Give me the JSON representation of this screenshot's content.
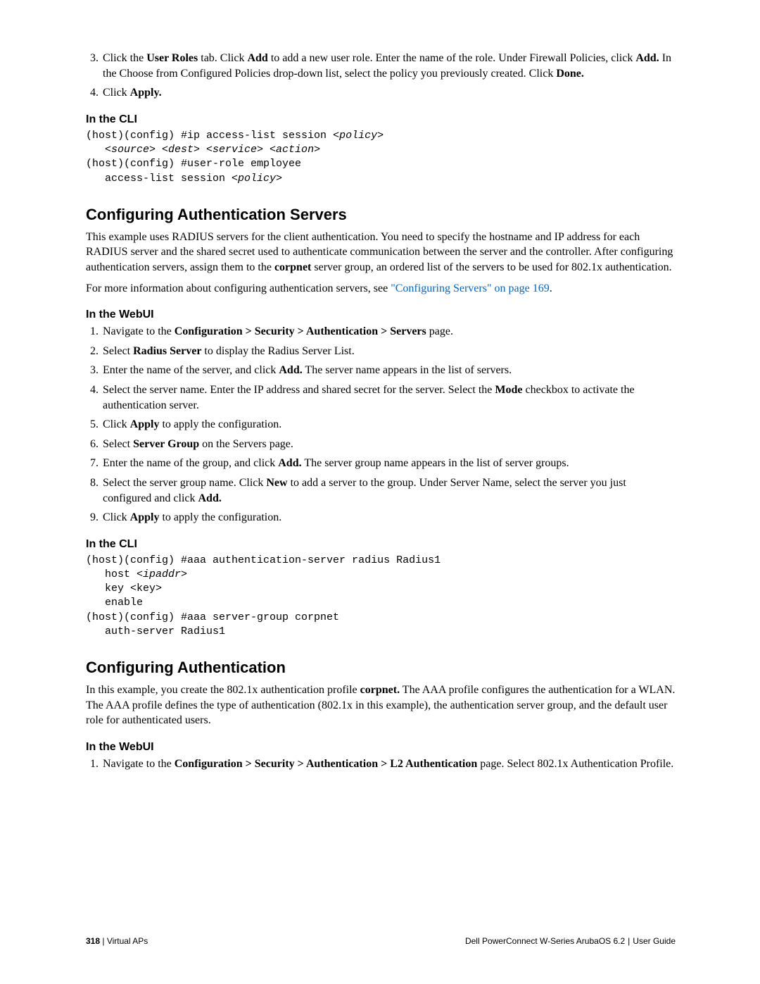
{
  "top_steps_start": 3,
  "top_steps": [
    {
      "pre": "Click the ",
      "b1": "User Roles",
      "mid1": " tab. Click ",
      "b2": "Add",
      "mid2": " to add a new user role. Enter the name of the role. Under Firewall Policies, click ",
      "b3": "Add.",
      "mid3": " In the Choose from Configured Policies drop-down list, select the policy you previously created. Click ",
      "b4": "Done.",
      "tail": ""
    },
    {
      "pre": "Click ",
      "b1": "Apply.",
      "mid1": "",
      "b2": "",
      "mid2": "",
      "b3": "",
      "mid3": "",
      "b4": "",
      "tail": ""
    }
  ],
  "cli_heading": "In the CLI",
  "cli1_l1a": "(host)(config) #ip access-list session ",
  "cli1_l1b": "<policy>",
  "cli1_l2a": "   ",
  "cli1_l2b": "<source> <dest> <service> <action>",
  "cli1_l3": "(host)(config) #user-role employee",
  "cli1_l4a": "   access-list session ",
  "cli1_l4b": "<policy>",
  "h2_auth_servers": "Configuring Authentication Servers",
  "auth_servers_p1a": "This example uses RADIUS servers for the client authentication. You need to specify the hostname and IP address for each RADIUS server and the shared secret used to authenticate communication between the server and the controller. After configuring authentication servers, assign them to the ",
  "auth_servers_p1b": "corpnet",
  "auth_servers_p1c": " server group, an ordered list of the servers to be used for 802.1x authentication.",
  "auth_servers_p2a": "For more information about configuring authentication servers, see ",
  "auth_servers_link": "\"Configuring Servers\" on page 169",
  "auth_servers_p2b": ".",
  "webui_heading": "In the WebUI",
  "webui1_steps": [
    {
      "t": [
        {
          "s": "Navigate to the "
        },
        {
          "b": "Configuration > Security > Authentication > Servers"
        },
        {
          "s": " page."
        }
      ]
    },
    {
      "t": [
        {
          "s": "Select "
        },
        {
          "b": "Radius Server"
        },
        {
          "s": " to display the Radius Server List."
        }
      ]
    },
    {
      "t": [
        {
          "s": "Enter the name of the server, and click "
        },
        {
          "b": "Add."
        },
        {
          "s": " The server name appears in the list of servers."
        }
      ]
    },
    {
      "t": [
        {
          "s": "Select the server name. Enter the IP address and shared secret for the server. Select the "
        },
        {
          "b": "Mode"
        },
        {
          "s": " checkbox to activate the authentication server."
        }
      ]
    },
    {
      "t": [
        {
          "s": "Click "
        },
        {
          "b": "Apply"
        },
        {
          "s": " to apply the configuration."
        }
      ]
    },
    {
      "t": [
        {
          "s": "Select "
        },
        {
          "b": "Server Group"
        },
        {
          "s": " on the Servers page."
        }
      ]
    },
    {
      "t": [
        {
          "s": "Enter the name of the group, and click "
        },
        {
          "b": "Add."
        },
        {
          "s": " The server group name appears in the list of server groups."
        }
      ]
    },
    {
      "t": [
        {
          "s": "Select the server group name. Click "
        },
        {
          "b": "New"
        },
        {
          "s": " to add a server to the group. Under Server Name, select the server you just configured and click "
        },
        {
          "b": "Add."
        }
      ]
    },
    {
      "t": [
        {
          "s": "Click "
        },
        {
          "b": "Apply"
        },
        {
          "s": " to apply the configuration."
        }
      ]
    }
  ],
  "cli2_l1": "(host)(config) #aaa authentication-server radius Radius1",
  "cli2_l2a": "   host ",
  "cli2_l2b": "<ipaddr>",
  "cli2_l3": "   key <key>",
  "cli2_l4": "   enable",
  "cli2_l5": "(host)(config) #aaa server-group corpnet",
  "cli2_l6": "   auth-server Radius1",
  "h2_config_auth": "Configuring Authentication",
  "config_auth_p1a": "In this example, you create the 802.1x authentication profile ",
  "config_auth_p1b": "corpnet.",
  "config_auth_p1c": " The AAA profile configures the authentication for a WLAN. The AAA profile defines the type of authentication (802.1x in this example), the authentication server group, and the default user role for authenticated users.",
  "webui2_steps": [
    {
      "t": [
        {
          "s": "Navigate to the "
        },
        {
          "b": "Configuration > Security > Authentication > L2 Authentication"
        },
        {
          "s": " page. Select 802.1x Authentication Profile."
        }
      ]
    }
  ],
  "footer": {
    "page": "318",
    "left_label": "Virtual APs",
    "right_product": "Dell PowerConnect W-Series ArubaOS 6.2",
    "right_doc": "User Guide"
  }
}
